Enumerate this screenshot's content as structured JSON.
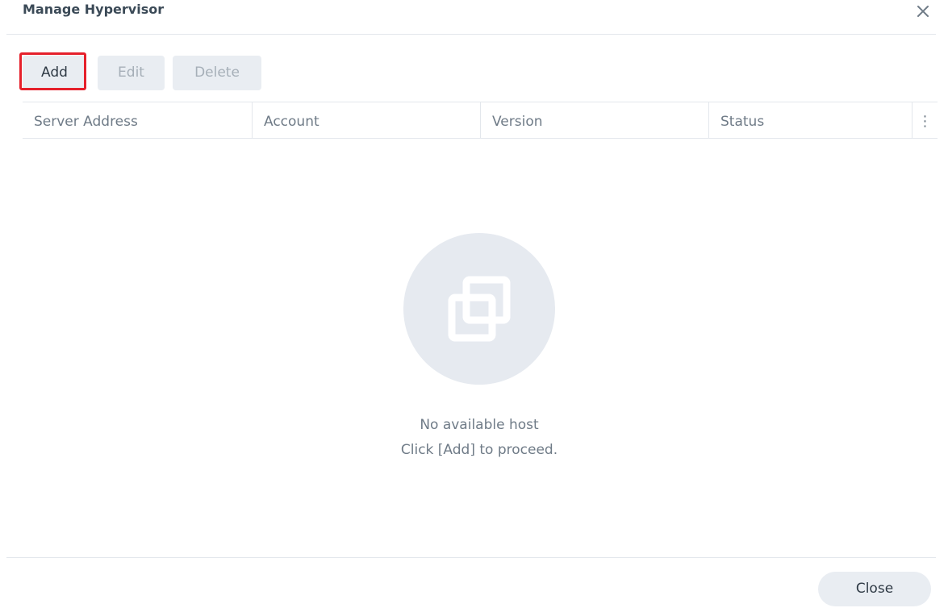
{
  "dialog": {
    "title": "Manage Hypervisor",
    "close_icon": "close-icon"
  },
  "toolbar": {
    "add_label": "Add",
    "edit_label": "Edit",
    "delete_label": "Delete",
    "edit_enabled": false,
    "delete_enabled": false,
    "highlighted": "Add"
  },
  "grid": {
    "columns": [
      "Server Address",
      "Account",
      "Version",
      "Status"
    ],
    "menu_icon": "more-vertical-icon",
    "rows": []
  },
  "empty_state": {
    "icon": "overlapping-squares-icon",
    "line1": "No available host",
    "line2": "Click [Add] to proceed."
  },
  "footer": {
    "close_label": "Close"
  },
  "colors": {
    "highlight": "#e5202b",
    "button_bg": "#e9edf2",
    "disabled_text": "#a6afb8"
  }
}
